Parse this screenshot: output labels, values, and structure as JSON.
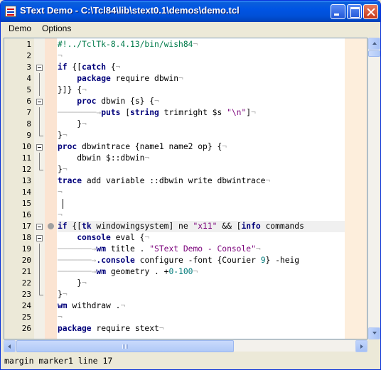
{
  "window": {
    "title": "SText Demo - C:\\Tcl84\\lib\\stext0.1\\demos\\demo.tcl"
  },
  "menu": [
    "Demo",
    "Options"
  ],
  "editor": {
    "lines": [
      {
        "num": "1",
        "fold": "",
        "html": "<span class=\"cmt\">#!../TclTk-8.4.13/bin/wish84</span><span class=\"eol\">¬</span>"
      },
      {
        "num": "2",
        "fold": "",
        "html": "<span class=\"eol\">¬</span>"
      },
      {
        "num": "3",
        "fold": "box",
        "html": "<span class=\"kw\">if</span> {[<span class=\"kw\">catch</span> {<span class=\"eol\">¬</span>"
      },
      {
        "num": "4",
        "fold": "line",
        "html": "    <span class=\"kw\">package</span> require dbwin<span class=\"eol\">¬</span>"
      },
      {
        "num": "5",
        "fold": "line",
        "html": "}]} {<span class=\"eol\">¬</span>"
      },
      {
        "num": "6",
        "fold": "box",
        "html": "    <span class=\"kw\">proc</span> dbwin {s} {<span class=\"eol\">¬</span>"
      },
      {
        "num": "7",
        "fold": "line",
        "html": "<span class=\"tabarrow\">────────→</span><span class=\"kw\">puts</span> [<span class=\"kw\">string</span> trimright $s <span class=\"str\">\"\\n\"</span>]<span class=\"eol\">¬</span>"
      },
      {
        "num": "8",
        "fold": "line",
        "html": "    }<span class=\"eol\">¬</span>"
      },
      {
        "num": "9",
        "fold": "end",
        "html": "}<span class=\"eol\">¬</span>"
      },
      {
        "num": "10",
        "fold": "box",
        "html": "<span class=\"kw\">proc</span> dbwintrace {name1 name2 op} {<span class=\"eol\">¬</span>"
      },
      {
        "num": "11",
        "fold": "line",
        "html": "    dbwin $::dbwin<span class=\"eol\">¬</span>"
      },
      {
        "num": "12",
        "fold": "end",
        "html": "}<span class=\"eol\">¬</span>"
      },
      {
        "num": "13",
        "fold": "",
        "html": "<span class=\"kw\">trace</span> add variable ::dbwin write dbwintrace<span class=\"eol\">¬</span>"
      },
      {
        "num": "14",
        "fold": "",
        "html": "<span class=\"eol\">¬</span>"
      },
      {
        "num": "15",
        "fold": "",
        "html": "",
        "caret": true
      },
      {
        "num": "16",
        "fold": "",
        "html": "<span class=\"eol\">¬</span>"
      },
      {
        "num": "17",
        "fold": "box",
        "html": "<span class=\"kw\">if</span> {[<span class=\"kw\">tk</span> windowingsystem] ne <span class=\"str\">\"x11\"</span> &amp;&amp; [<span class=\"kw\">info</span> commands",
        "marker": true,
        "highlight": true
      },
      {
        "num": "18",
        "fold": "box",
        "html": "    <span class=\"kw\">console</span> eval {<span class=\"eol\">¬</span>"
      },
      {
        "num": "19",
        "fold": "line",
        "html": "<span class=\"tabarrow\">───────→</span><span class=\"kw\">wm</span> title . <span class=\"str\">\"SText Demo - Console\"</span><span class=\"eol\">¬</span>"
      },
      {
        "num": "20",
        "fold": "line",
        "html": "<span class=\"tabarrow\">───────→</span><span class=\"kw\">.console</span> configure -font {Courier <span class=\"num\">9</span>} -heig"
      },
      {
        "num": "21",
        "fold": "line",
        "html": "<span class=\"tabarrow\">───────→</span><span class=\"kw\">wm</span> geometry . +<span class=\"num\">0-100</span><span class=\"eol\">¬</span>"
      },
      {
        "num": "22",
        "fold": "line",
        "html": "    }<span class=\"eol\">¬</span>"
      },
      {
        "num": "23",
        "fold": "end",
        "html": "}<span class=\"eol\">¬</span>"
      },
      {
        "num": "24",
        "fold": "",
        "html": "<span class=\"kw\">wm</span> withdraw .<span class=\"eol\">¬</span>"
      },
      {
        "num": "25",
        "fold": "",
        "html": "<span class=\"eol\">¬</span>"
      },
      {
        "num": "26",
        "fold": "",
        "html": "<span class=\"kw\">package</span> require stext<span class=\"eol\">¬</span>"
      }
    ]
  },
  "statusbar": {
    "text": "margin marker1 line 17"
  }
}
